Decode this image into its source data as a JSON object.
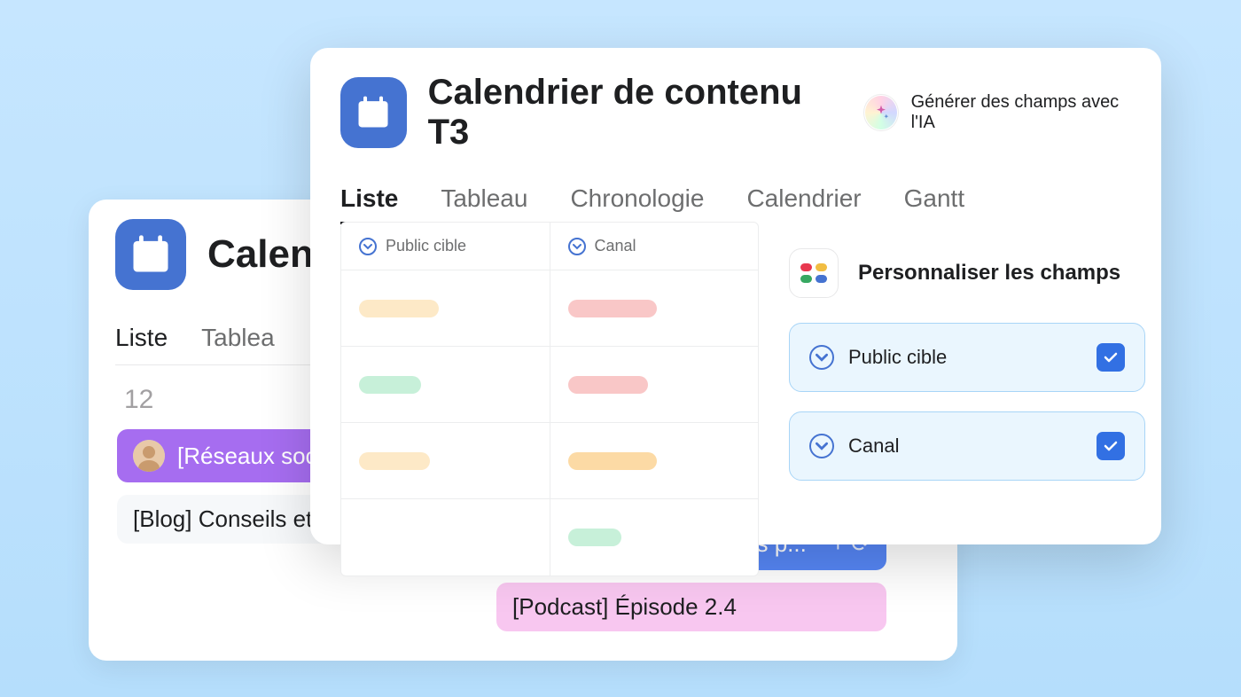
{
  "back": {
    "title": "Calen",
    "tabs": {
      "liste": "Liste",
      "tableau": "Tablea"
    },
    "day": "12",
    "events_col1": [
      {
        "text": "[Réseaux soc"
      },
      {
        "text": "[Blog] Conseils et astuces"
      }
    ],
    "events_col2": [
      {
        "text": "[E-book] Les bonnes p...",
        "extra": "+ ⟳"
      },
      {
        "text": "[Podcast] Épisode 2.4"
      }
    ]
  },
  "front": {
    "title": "Calendrier de contenu T3",
    "ai_text": "Générer des champs avec l'IA",
    "tabs": {
      "liste": "Liste",
      "tableau": "Tableau",
      "chronologie": "Chronologie",
      "calendrier": "Calendrier",
      "gantt": "Gantt"
    },
    "list_columns": {
      "col1": "Public cible",
      "col2": "Canal"
    },
    "customize": {
      "title": "Personnaliser les champs",
      "field1": "Public cible",
      "field2": "Canal"
    }
  }
}
